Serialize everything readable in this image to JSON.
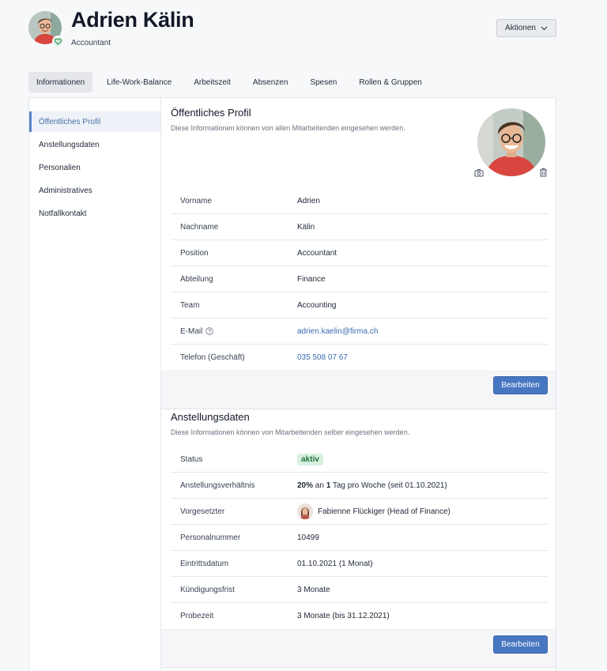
{
  "header": {
    "name": "Adrien Kälin",
    "role": "Accountant",
    "actions_label": "Aktionen"
  },
  "tabs": [
    {
      "label": "Informationen",
      "active": true
    },
    {
      "label": "Life-Work-Balance"
    },
    {
      "label": "Arbeitszeit"
    },
    {
      "label": "Absenzen"
    },
    {
      "label": "Spesen"
    },
    {
      "label": "Rollen & Gruppen"
    }
  ],
  "sidenav": [
    {
      "label": "Öffentliches Profil",
      "active": true
    },
    {
      "label": "Anstellungsdaten"
    },
    {
      "label": "Personalien"
    },
    {
      "label": "Administratives"
    },
    {
      "label": "Notfallkontakt"
    }
  ],
  "profile": {
    "title": "Öffentliches Profil",
    "description": "Diese Informationen können von allen Mitarbeitenden eingesehen werden.",
    "fields": {
      "vorname": {
        "label": "Vorname",
        "value": "Adrien"
      },
      "nachname": {
        "label": "Nachname",
        "value": "Kälin"
      },
      "position": {
        "label": "Position",
        "value": "Accountant"
      },
      "abteilung": {
        "label": "Abteilung",
        "value": "Finance"
      },
      "team": {
        "label": "Team",
        "value": "Accounting"
      },
      "email": {
        "label": "E-Mail",
        "value": "adrien.kaelin@firma.ch"
      },
      "telefon": {
        "label": "Telefon (Geschäft)",
        "value": "035 508 07 67"
      }
    },
    "edit_label": "Bearbeiten"
  },
  "employment": {
    "title": "Anstellungsdaten",
    "description": "Diese Informationen können von Mitarbeitenden selber eingesehen werden.",
    "fields": {
      "status": {
        "label": "Status",
        "value": "aktiv"
      },
      "verhaeltnis": {
        "label": "Anstellungsverhältnis",
        "percent": "20%",
        "mid1": " an ",
        "days": "1",
        "mid2": " Tag pro Woche (seit 01.10.2021)"
      },
      "vorgesetzter": {
        "label": "Vorgesetzter",
        "value": "Fabienne Flückiger (Head of Finance)"
      },
      "personalnummer": {
        "label": "Personalnummer",
        "value": "10499"
      },
      "eintritt": {
        "label": "Eintrittsdatum",
        "value": "01.10.2021 (1 Monat)"
      },
      "kuendigung": {
        "label": "Kündigungsfrist",
        "value": "3 Monate"
      },
      "probezeit": {
        "label": "Probezeit",
        "value": "3 Monate (bis 31.12.2021)"
      }
    },
    "edit_label": "Bearbeiten"
  },
  "colors": {
    "accent": "#4777c1",
    "link": "#3b6bb0",
    "status_bg": "#d8f0df",
    "status_fg": "#1f6f3a"
  }
}
